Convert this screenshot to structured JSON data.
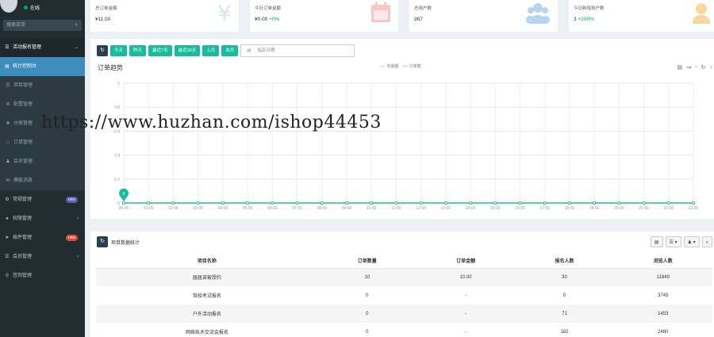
{
  "sidebar": {
    "status": "在线",
    "search_placeholder": "搜索菜单",
    "items": [
      {
        "label": "活动报名管理",
        "icon": "list-icon"
      },
      {
        "label": "统计控制台",
        "icon": "chart-icon"
      },
      {
        "label": "项目管理",
        "icon": "list-icon"
      },
      {
        "label": "配置管理",
        "icon": "gear-icon"
      },
      {
        "label": "分类管理",
        "icon": "tags-icon"
      },
      {
        "label": "订单管理",
        "icon": "order-icon"
      },
      {
        "label": "会员管理",
        "icon": "user-icon"
      },
      {
        "label": "模板消息",
        "icon": "message-icon"
      },
      {
        "label": "常规管理",
        "icon": "cogs-icon",
        "badge": "new"
      },
      {
        "label": "权限管理",
        "icon": "group-icon"
      },
      {
        "label": "插件管理",
        "icon": "rocket-icon",
        "badge": "new"
      },
      {
        "label": "会员管理",
        "icon": "list-icon"
      },
      {
        "label": "签到管理",
        "icon": "pin-icon"
      }
    ]
  },
  "stats": [
    {
      "label": "总订单金额",
      "value": "¥11.00",
      "pct": "",
      "icon": "yen-icon",
      "color": "#d9e4f7"
    },
    {
      "label": "今日订单金额",
      "value": "¥0.00",
      "pct": "+0%",
      "icon": "calendar-icon",
      "color": "#f7c6c6"
    },
    {
      "label": "总用户数",
      "value": "967",
      "pct": "",
      "icon": "users-icon",
      "color": "#b6d4f0"
    },
    {
      "label": "今日新增用户数",
      "value": "3",
      "pct": "+200%",
      "icon": "user-icon",
      "color": "#f9d6a0"
    }
  ],
  "toolbar": {
    "buttons": [
      "今天",
      "昨天",
      "最近7天",
      "最近30天",
      "上月",
      "本月"
    ],
    "date_placeholder": "指定日期"
  },
  "chart_title": "订单趋势",
  "legend": [
    "交易额",
    "订单数"
  ],
  "watermark": "https://www.huzhan.com/ishop44453",
  "chart_data": {
    "type": "line",
    "title": "订单趋势",
    "categories": [
      "00:00",
      "01:00",
      "02:00",
      "03:00",
      "04:00",
      "05:00",
      "06:00",
      "07:00",
      "08:00",
      "09:00",
      "10:00",
      "11:00",
      "12:00",
      "13:00",
      "14:00",
      "15:00",
      "16:00",
      "17:00",
      "18:00",
      "19:00",
      "20:00",
      "21:00",
      "22:00",
      "23:00"
    ],
    "ylim": [
      0,
      1
    ],
    "yticks": [
      "0",
      "0.2",
      "0.4",
      "0.6",
      "0.8",
      "1"
    ],
    "series": [
      {
        "name": "交易额",
        "values": [
          0,
          0,
          0,
          0,
          0,
          0,
          0,
          0,
          0,
          0,
          0,
          0,
          0,
          0,
          0,
          0,
          0,
          0,
          0,
          0,
          0,
          0,
          0,
          0
        ]
      },
      {
        "name": "订单数",
        "values": [
          0,
          0,
          0,
          0,
          0,
          0,
          0,
          0,
          0,
          0,
          0,
          0,
          0,
          0,
          0,
          0,
          0,
          0,
          0,
          0,
          0,
          0,
          0,
          0
        ]
      }
    ],
    "marker_label": "0",
    "color": "#18bc9c"
  },
  "table": {
    "title": "项目数据统计",
    "columns": [
      "项目名称",
      "订单数量",
      "订单金额",
      "报名人数",
      "浏览人数"
    ],
    "rows": [
      [
        "届届读被授约",
        "10",
        "10.00",
        "30",
        "11849"
      ],
      [
        "驾校考试报名",
        "0",
        "-",
        "0",
        "3745"
      ],
      [
        "户外活动报名",
        "0",
        "-",
        "71",
        "1453"
      ],
      [
        "网络技术交流会报名",
        "0",
        "-",
        "182",
        "2460"
      ]
    ]
  }
}
